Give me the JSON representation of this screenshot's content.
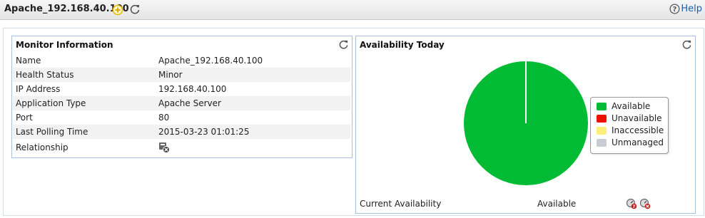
{
  "header": {
    "title": "Apache_192.168.40.100",
    "help_label": "Help"
  },
  "monitor_panel": {
    "title": "Monitor Information",
    "rows": [
      {
        "label": "Name",
        "value": "Apache_192.168.40.100"
      },
      {
        "label": "Health Status",
        "value": "Minor"
      },
      {
        "label": "IP Address",
        "value": "192.168.40.100"
      },
      {
        "label": "Application Type",
        "value": "Apache Server"
      },
      {
        "label": "Port",
        "value": "80"
      },
      {
        "label": "Last Polling Time",
        "value": "2015-03-23 01:01:25"
      },
      {
        "label": "Relationship",
        "value": ""
      }
    ]
  },
  "availability_panel": {
    "title": "Availability Today",
    "legend": [
      {
        "label": "Available",
        "color": "#00bb33"
      },
      {
        "label": "Unavailable",
        "color": "#ee1100"
      },
      {
        "label": "Inaccessible",
        "color": "#ffee77"
      },
      {
        "label": "Unmanaged",
        "color": "#c8ccd4"
      }
    ],
    "current_label": "Current Availability",
    "current_value": "Available"
  },
  "chart_data": {
    "type": "pie",
    "categories": [
      "Available",
      "Unavailable",
      "Inaccessible",
      "Unmanaged"
    ],
    "values": [
      100,
      0,
      0,
      0
    ],
    "title": "Availability Today",
    "legend": "right"
  }
}
